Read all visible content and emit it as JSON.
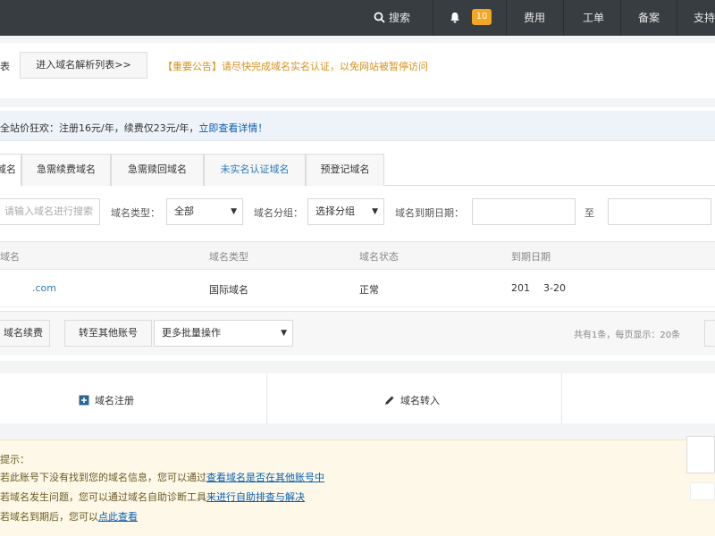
{
  "topbar": {
    "search_label": "搜索",
    "badge_count": "10",
    "nav": [
      "费用",
      "工单",
      "备案",
      "支持"
    ]
  },
  "domain_section": {
    "prefix": "表",
    "enter_button": "进入域名解析列表>>",
    "notice": "【重要公告】请尽快完成域名实名认证，以免网站被暂停访问"
  },
  "promo": {
    "text": "全站价狂欢：注册16元/年，续费仅23元/年，",
    "link": "立即查看详情！"
  },
  "tabs": [
    "域名",
    "急需续费域名",
    "急需赎回域名",
    "未实名认证域名",
    "预登记域名"
  ],
  "filters": {
    "search_placeholder": "请输入域名进行搜索",
    "type_label": "域名类型：",
    "type_value": "全部",
    "group_label": "域名分组：",
    "group_value": "选择分组",
    "expire_label": "域名到期日期：",
    "to_label": "至"
  },
  "table": {
    "headers": [
      "域名",
      "域名类型",
      "域名状态",
      "到期日期"
    ],
    "rows": [
      {
        "domain": ".com",
        "type": "国际域名",
        "status": "正常",
        "expire_prefix": "201",
        "expire_suffix": "3-20"
      }
    ]
  },
  "bulk": {
    "renew_button": "域名续费",
    "transfer_button": "转至其他账号",
    "more_select": "更多批量操作",
    "pager_text": "共有1条，每页显示：20条"
  },
  "actions": {
    "register": "域名注册",
    "transfer_in": "域名转入"
  },
  "tips": {
    "title": "提示：",
    "line1_text": "若此账号下没有找到您的域名信息，您可以通过",
    "line1_link": "查看域名是否在其他账号中",
    "line2_text": "若域名发生问题，您可以通过域名自助诊断工具",
    "line2_link": "来进行自助排查与解决",
    "line3_text": "若域名到期后，您可以",
    "line3_link": "点此查看"
  }
}
